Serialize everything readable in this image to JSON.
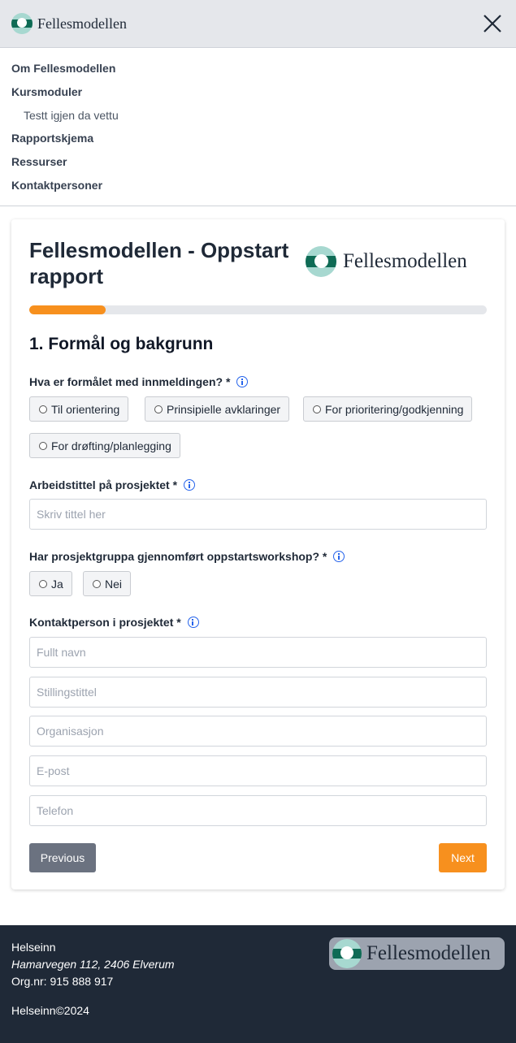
{
  "header": {
    "brand": "Fellesmodellen"
  },
  "nav": {
    "items": [
      "Om Fellesmodellen",
      "Kursmoduler",
      "Rapportskjema",
      "Ressurser",
      "Kontaktpersoner"
    ],
    "subitem": "Testt igjen da vettu"
  },
  "form": {
    "title": "Fellesmodellen - Oppstart rapport",
    "logo_text": "Fellesmodellen",
    "progress_fraction": 0.167,
    "section_title": "1. Formål og bakgrunn",
    "q1": {
      "label": "Hva er formålet med innmeldingen? *",
      "options": [
        "Til orientering",
        "Prinsipielle avklaringer",
        "For prioritering/godkjenning",
        "For drøfting/planlegging"
      ]
    },
    "q2": {
      "label": "Arbeidstittel på prosjektet *",
      "placeholder": "Skriv tittel her"
    },
    "q3": {
      "label": "Har prosjektgruppa gjennomført oppstartsworkshop? *",
      "options": [
        "Ja",
        "Nei"
      ]
    },
    "q4": {
      "label": "Kontaktperson i prosjektet *",
      "placeholders": [
        "Fullt navn",
        "Stillingstittel",
        "Organisasjon",
        "E-post",
        "Telefon"
      ]
    },
    "buttons": {
      "previous": "Previous",
      "next": "Next"
    }
  },
  "footer": {
    "name": "Helseinn",
    "address": "Hamarvegen 112, 2406 Elverum",
    "orgnr": "Org.nr: 915 888 917",
    "copyright": "Helseinn©2024",
    "logo_text": "Fellesmodellen"
  },
  "colors": {
    "accent": "#f7901e",
    "footer_bg": "#1f2937",
    "header_bg": "#e5e7eb",
    "secondary_button": "#6b7280"
  }
}
